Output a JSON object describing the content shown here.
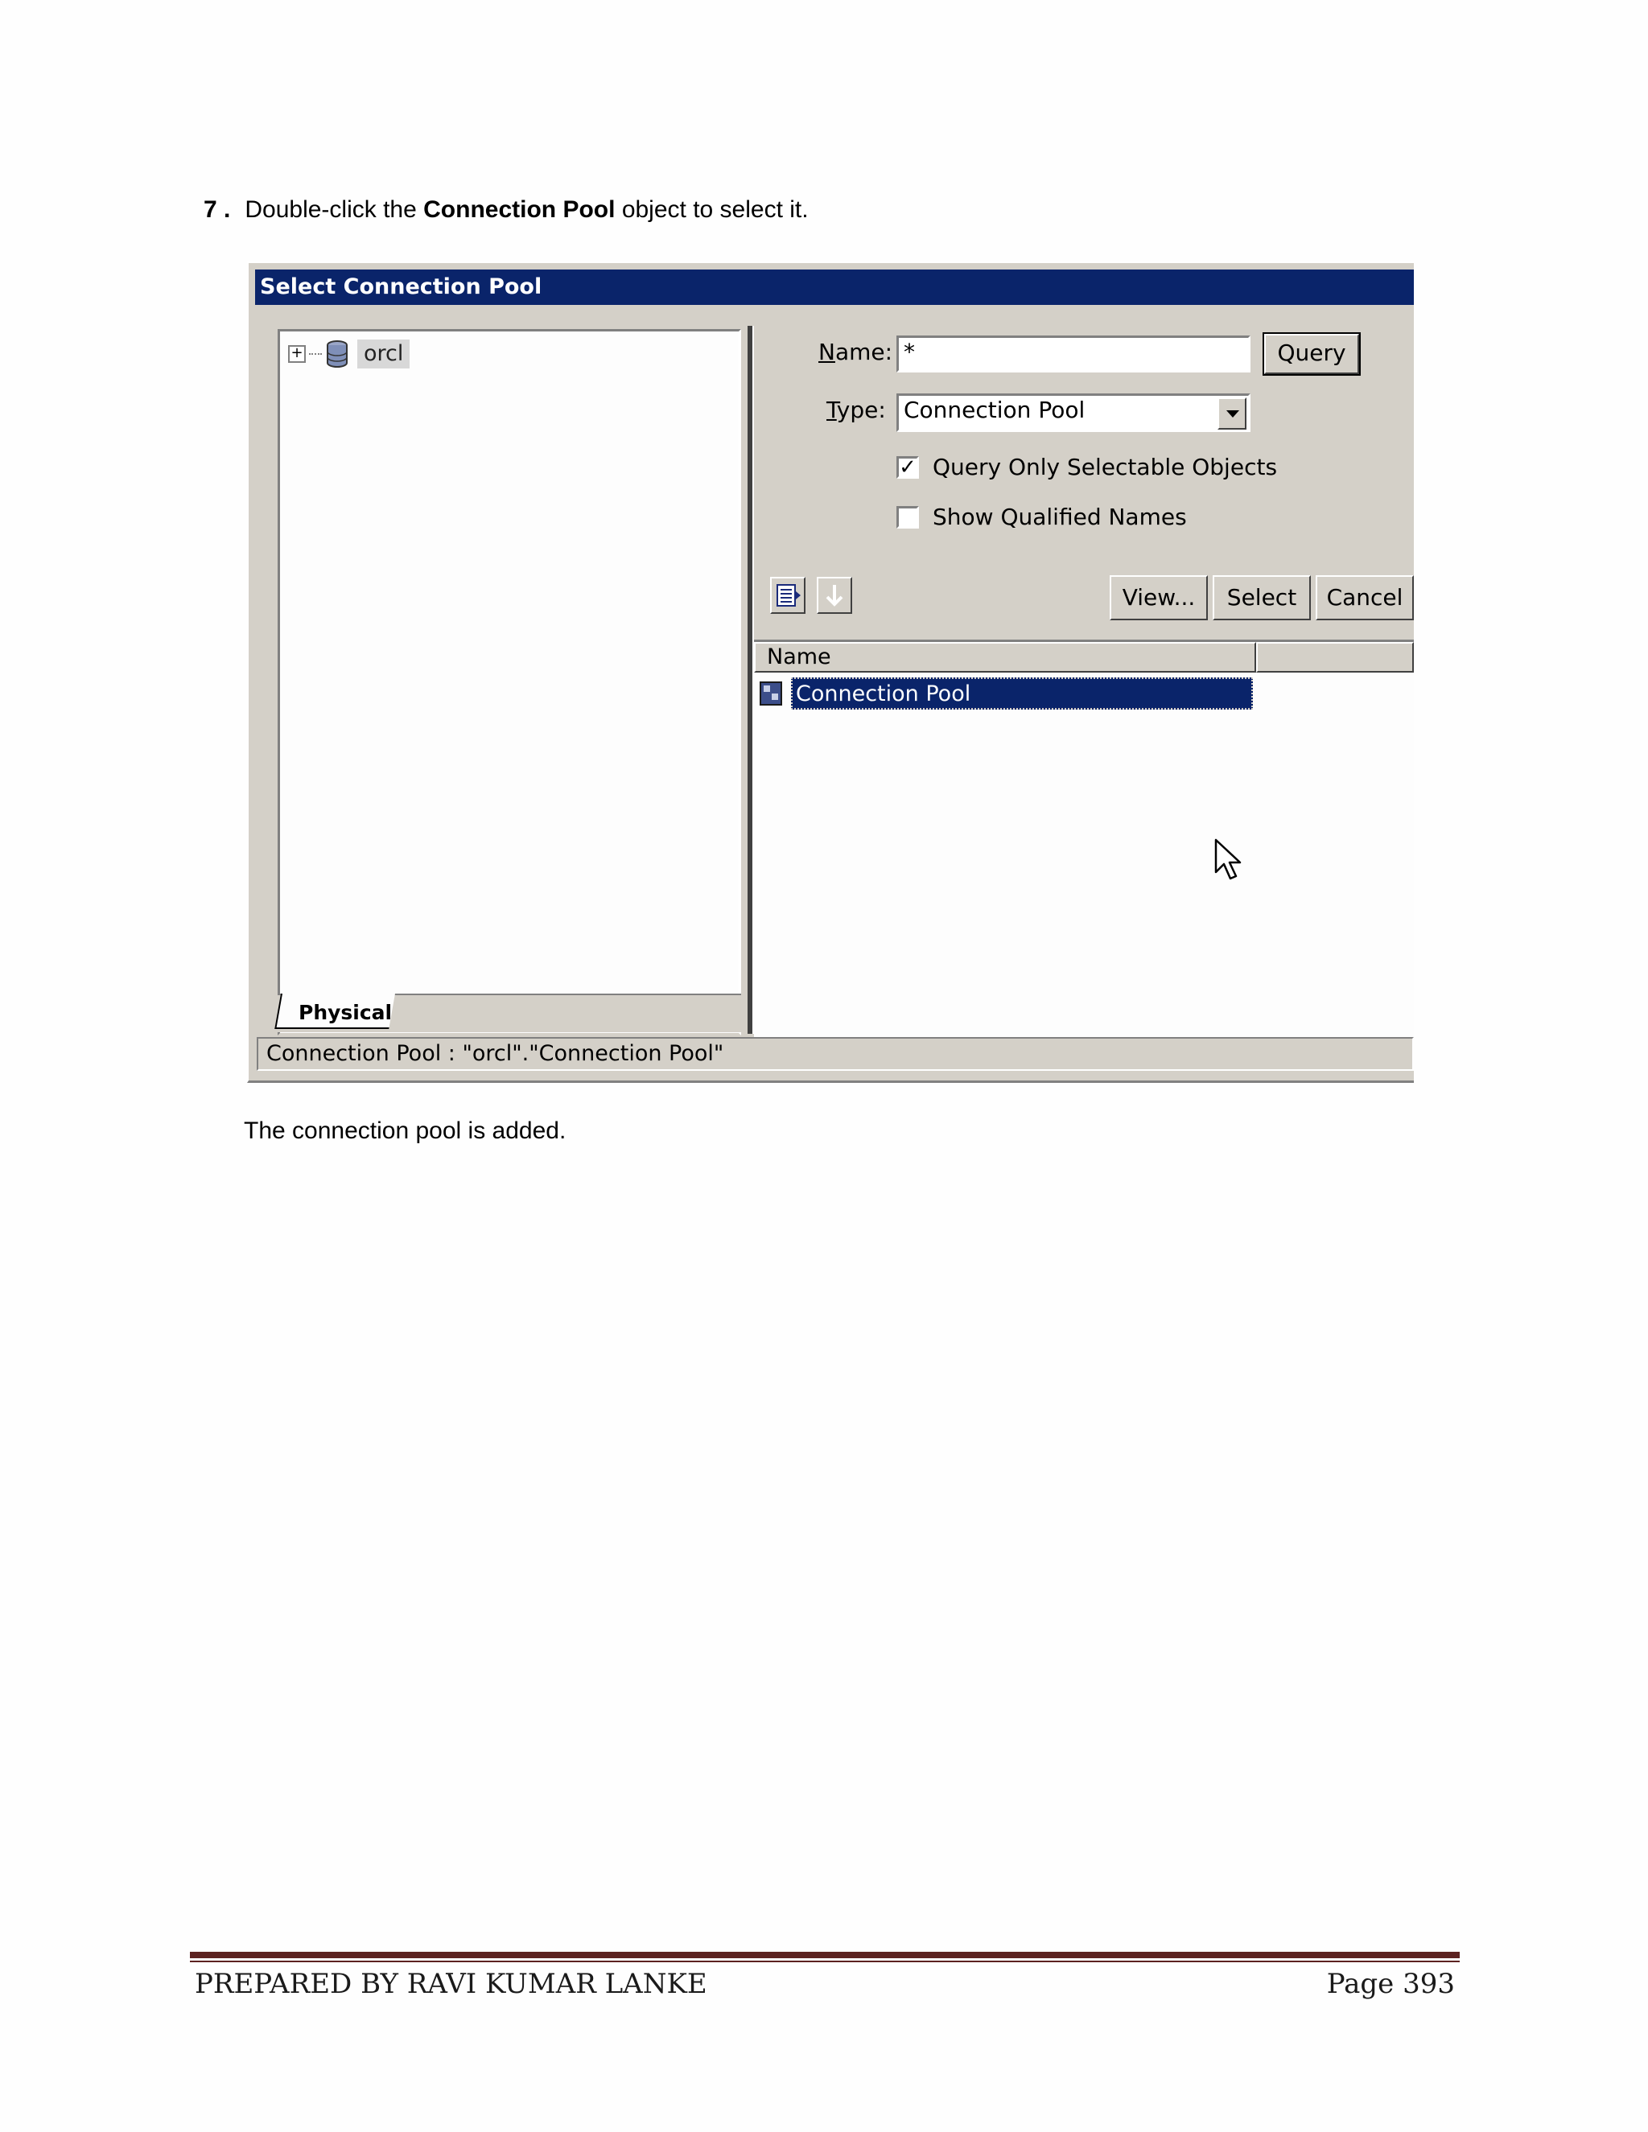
{
  "instruction": {
    "number": "7 .",
    "before": "Double-click the",
    "bold": "Connection Pool",
    "after": "object to select it."
  },
  "dialog": {
    "title": "Select Connection Pool",
    "tree": {
      "node_label": "orcl",
      "tab_label": "Physical"
    },
    "name_label_mnemonic": "N",
    "name_label_rest": "ame:",
    "name_value": "*",
    "type_label_mnemonic": "T",
    "type_label_rest": "ype:",
    "type_value": "Connection Pool",
    "query_button": "Query",
    "checkbox_query_only": {
      "label": "Query Only Selectable Objects",
      "checked": true
    },
    "checkbox_show_qualified": {
      "label": "Show Qualified Names",
      "checked": false
    },
    "buttons": {
      "view": "View...",
      "select": "Select",
      "cancel": "Cancel"
    },
    "list": {
      "columns": [
        "Name",
        ""
      ],
      "rows": [
        {
          "name": "Connection Pool",
          "selected": true
        }
      ]
    },
    "status": "Connection Pool : \"orcl\".\"Connection Pool\""
  },
  "caption": "The connection pool is added.",
  "footer": {
    "left": "PREPARED BY RAVI KUMAR LANKE",
    "right": "Page 393"
  },
  "colors": {
    "title_bar": "#0a246a",
    "selection": "#0a246a",
    "dialog_face": "#d4d0c8",
    "footer_rule": "#5c2220"
  }
}
